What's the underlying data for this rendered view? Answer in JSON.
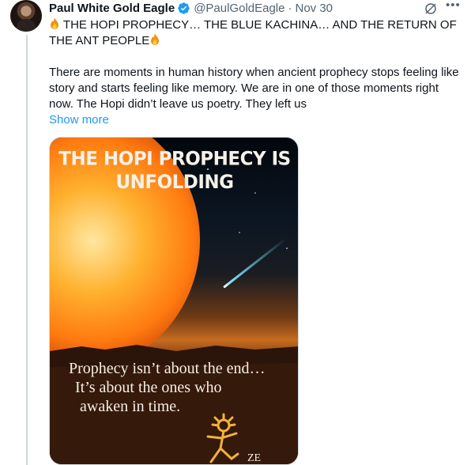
{
  "tweet": {
    "author_name": "Paul White Gold Eagle",
    "handle": "@PaulGoldEagle",
    "separator": "·",
    "date": "Nov 30",
    "line1": "THE HOPI PROPHECY… THE BLUE KACHINA… AND THE RETURN OF THE ANT PEOPLE",
    "line2": "There are moments in human history when ancient prophecy stops feeling like story and starts feeling like memory. We are in one of those moments right now. The Hopi didn’t leave us poetry. They left us",
    "show_more": "Show more"
  },
  "media": {
    "title": "THE HOPI PROPHECY IS UNFOLDING",
    "caption_lines": [
      "Prophecy isn’t about the end…",
      "It’s about the ones who",
      "awaken in time."
    ],
    "signature": "ZE"
  },
  "icons": {
    "verified": "verified-badge-icon",
    "grok": "grok-icon",
    "more": "more-options-icon",
    "fire": "fire-emoji-icon"
  },
  "colors": {
    "link": "#1d9bf0",
    "secondary_text": "#536471",
    "verified": "#1d9bf0",
    "thread_line": "#cfd9de"
  }
}
